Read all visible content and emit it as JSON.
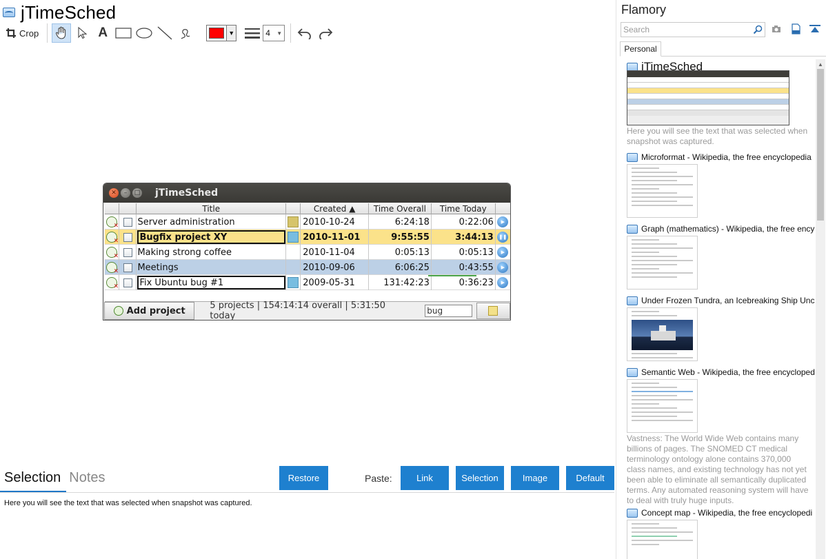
{
  "app": {
    "title": "jTimeSched"
  },
  "toolbar": {
    "crop_label": "Crop",
    "text_tool": "A",
    "line_width": "4",
    "color": "#ff0000"
  },
  "snapshot": {
    "window_title": "jTimeSched",
    "columns": [
      "Title",
      "Created ▲",
      "Time Overall",
      "Time Today"
    ],
    "rows": [
      {
        "title": "Server administration",
        "created": "2010-10-24",
        "overall": "6:24:18",
        "today": "0:22:06"
      },
      {
        "title": "Bugfix project XY",
        "created": "2010-11-01",
        "overall": "9:55:55",
        "today": "3:44:13"
      },
      {
        "title": "Making strong coffee",
        "created": "2010-11-04",
        "overall": "0:05:13",
        "today": "0:05:13"
      },
      {
        "title": "Meetings",
        "created": "2010-09-06",
        "overall": "6:06:25",
        "today": "0:43:55"
      },
      {
        "title": "Fix Ubuntu bug #1",
        "created": "2009-05-31",
        "overall": "131:42:23",
        "today": "0:36:23"
      }
    ],
    "add_button": "Add project",
    "status": "5 projects | 154:14:14 overall | 5:31:50 today",
    "filter_value": "bug"
  },
  "bottom": {
    "tab_selection": "Selection",
    "tab_notes": "Notes",
    "restore": "Restore",
    "paste_label": "Paste:",
    "paste_link": "Link",
    "paste_selection": "Selection",
    "paste_image": "Image",
    "paste_default": "Default",
    "selection_text": "Here you will see the text that was selected when snapshot was captured."
  },
  "sidebar": {
    "title": "Flamory",
    "search_placeholder": "Search",
    "tab": "Personal",
    "items": [
      {
        "title": "jTimeSched",
        "desc": "Here you will see the text that was selected when snapshot was captured."
      },
      {
        "title": "Microformat - Wikipedia, the free encyclopedia"
      },
      {
        "title": "Graph (mathematics) - Wikipedia, the free ency"
      },
      {
        "title": "Under Frozen Tundra, an Icebreaking Ship Unco"
      },
      {
        "title": "Semantic Web - Wikipedia, the free encycloped",
        "desc": "Vastness: The World Wide Web contains many billions of pages. The SNOMED CT medical terminology ontology alone contains 370,000 class names, and existing technology has not yet been able to eliminate all semantically duplicated terms. Any automated reasoning system will have to deal with truly huge inputs."
      },
      {
        "title": "Concept map - Wikipedia, the free encyclopedi"
      }
    ]
  },
  "colors": {
    "accent": "#1e80cf",
    "selected_row": "#fbe28a",
    "alt_row": "#bcd0e6"
  }
}
